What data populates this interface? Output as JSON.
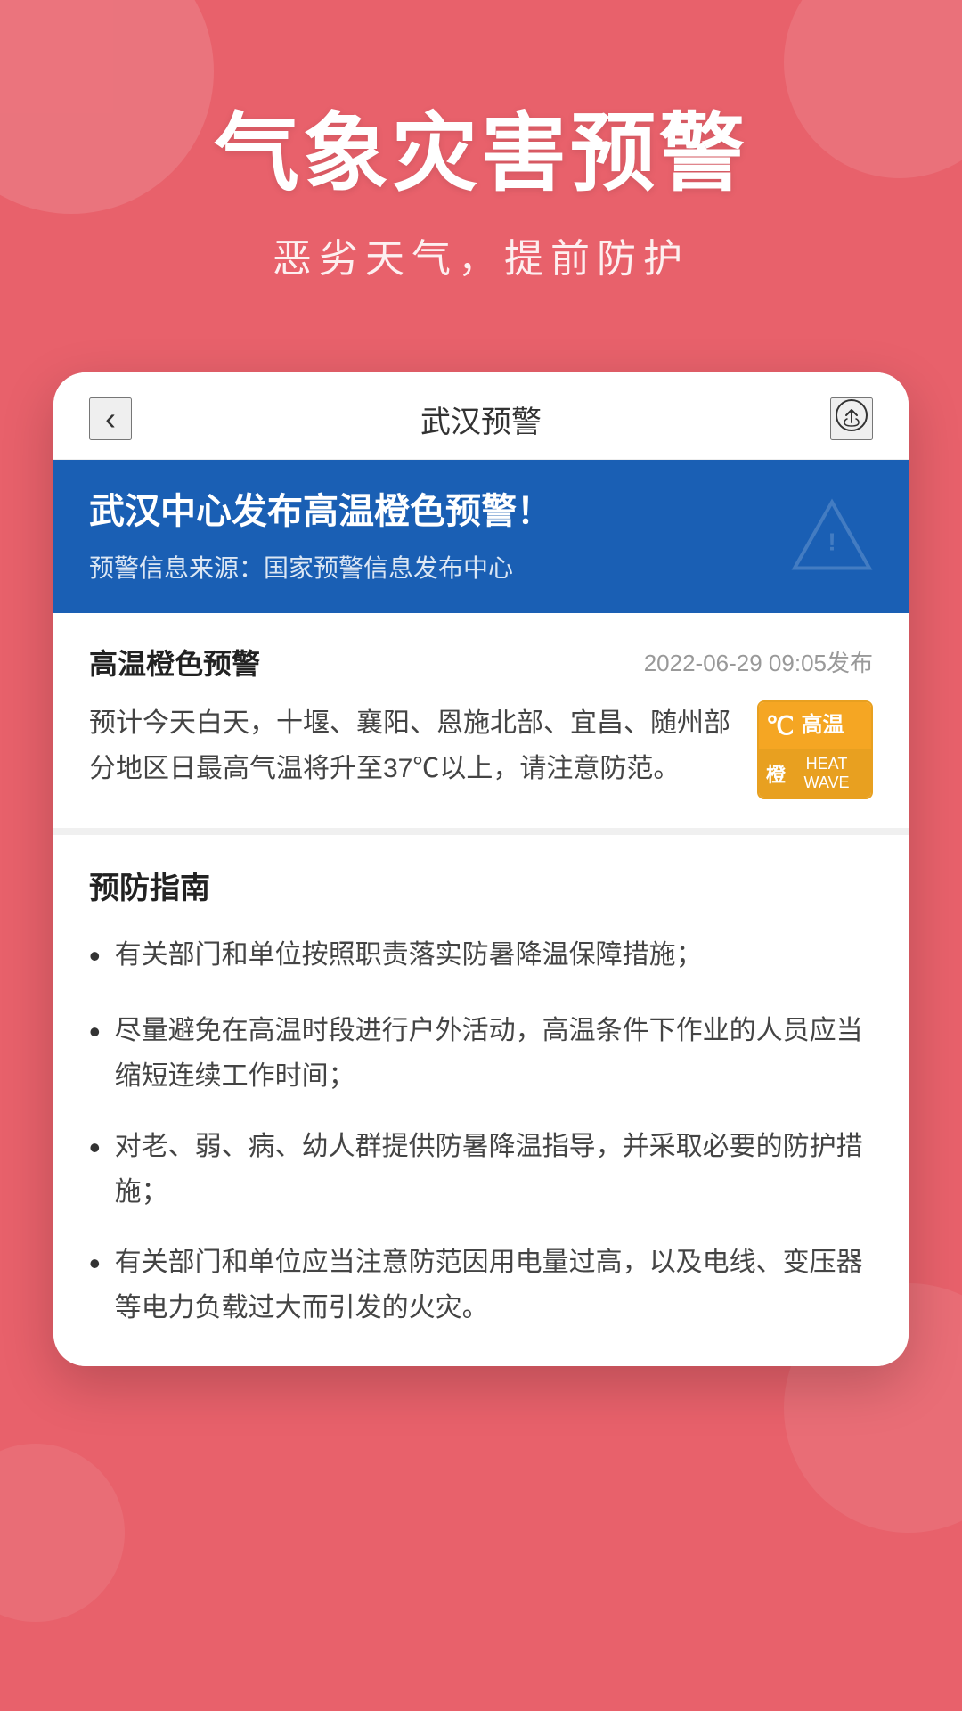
{
  "background_color": "#e8616b",
  "header": {
    "main_title": "气象灾害预警",
    "subtitle": "恶劣天气，提前防护"
  },
  "navbar": {
    "back_label": "‹",
    "title": "武汉预警",
    "share_label": "↗"
  },
  "alert_banner": {
    "title": "武汉中心发布高温橙色预警！",
    "source_prefix": "预警信息来源：",
    "source": "国家预警信息发布中心"
  },
  "alert_detail": {
    "type_label": "高温橙色预警",
    "timestamp": "2022-06-29 09:05发布",
    "body_text": "预计今天白天，十堰、襄阳、恩施北部、宜昌、随州部分地区日最高气温将升至37℃以上，请注意防范。"
  },
  "heatwave_badge": {
    "temp_icon": "℃",
    "top_label": "高温",
    "level": "橙",
    "wave_text": "HEAT WAVE"
  },
  "prevention": {
    "title": "预防指南",
    "items": [
      "有关部门和单位按照职责落实防暑降温保障措施；",
      "尽量避免在高温时段进行户外活动，高温条件下作业的人员应当缩短连续工作时间；",
      "对老、弱、病、幼人群提供防暑降温指导，并采取必要的防护措施；",
      "有关部门和单位应当注意防范因用电量过高，以及电线、变压器等电力负载过大而引发的火灾。"
    ]
  }
}
